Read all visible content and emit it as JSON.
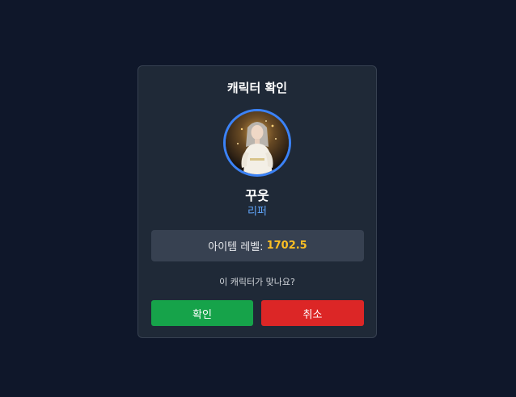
{
  "dialog": {
    "title": "캐릭터 확인",
    "character": {
      "name": "꾸웃",
      "class": "리퍼",
      "avatar_alt": "character-portrait"
    },
    "item_level": {
      "label": "아이템 레벨:",
      "value": "1702.5"
    },
    "question": "이 캐릭터가 맞나요?",
    "buttons": {
      "confirm": "확인",
      "cancel": "취소"
    }
  },
  "colors": {
    "background": "#0f172a",
    "dialog": "#1f2937",
    "avatar_border": "#3b82f6",
    "class_text": "#60a5fa",
    "level_value": "#fbbf24",
    "confirm": "#16a34a",
    "cancel": "#dc2626"
  }
}
